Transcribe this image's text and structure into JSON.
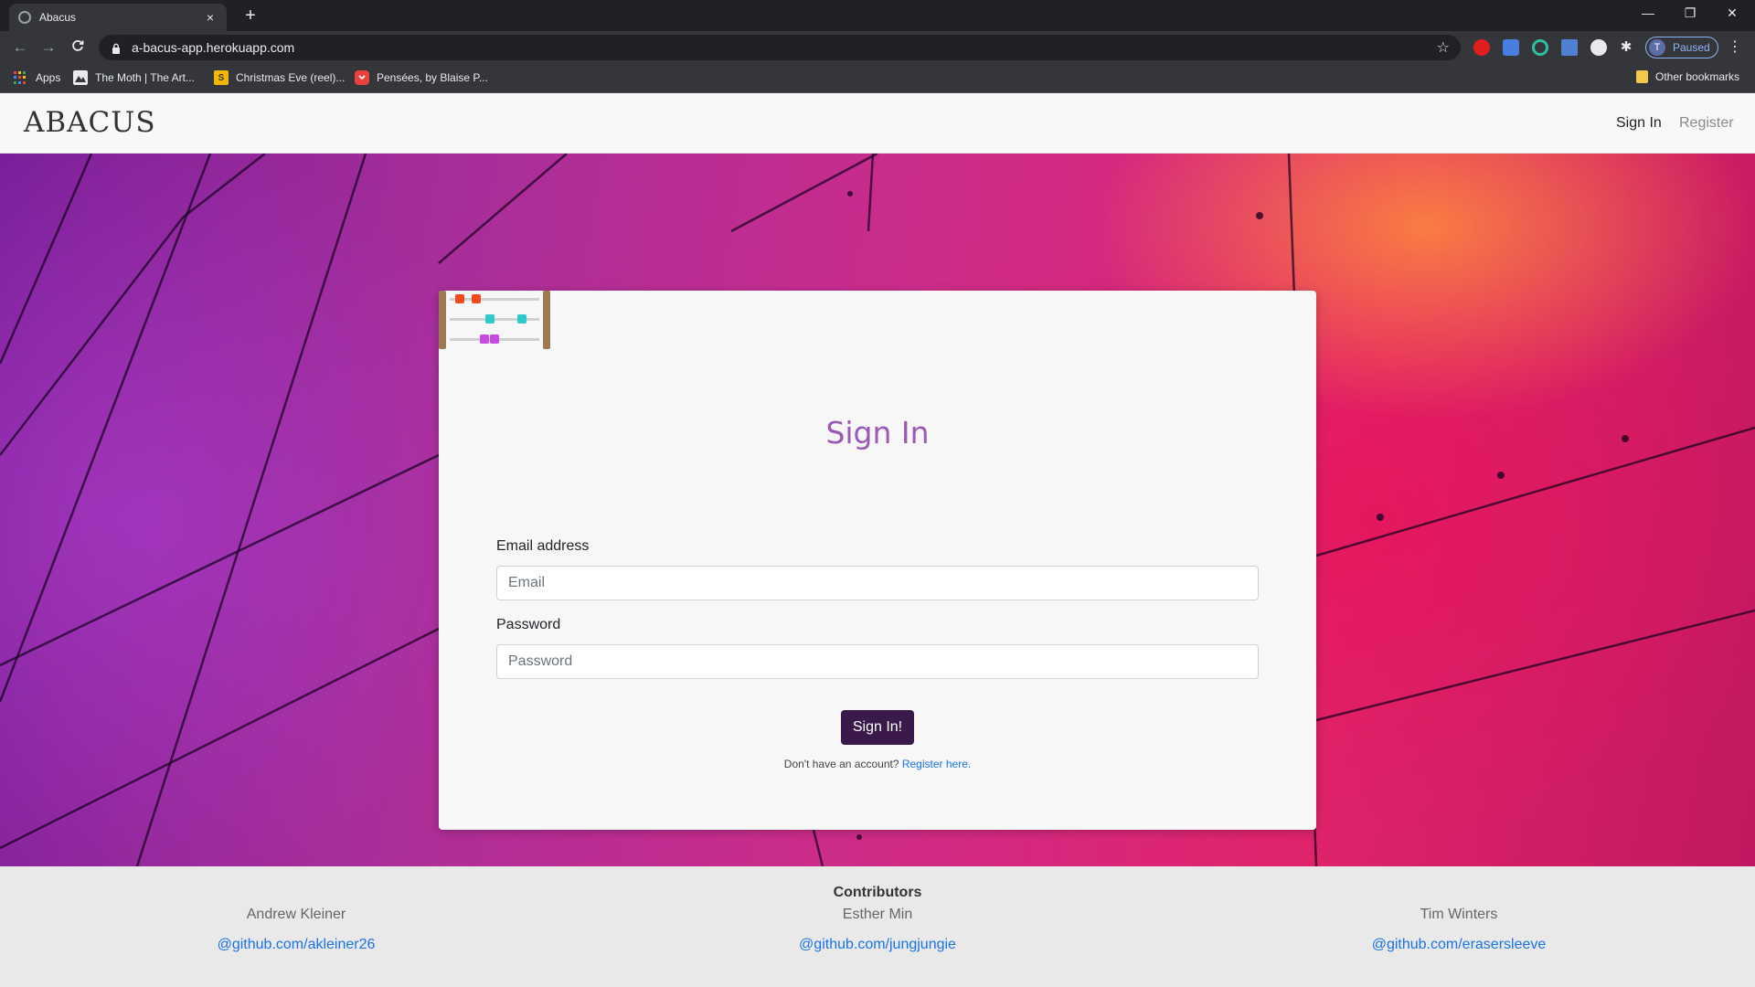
{
  "browser": {
    "tab_title": "Abacus",
    "tab_close": "×",
    "new_tab": "+",
    "url": "a-bacus-app.herokuapp.com",
    "profile_initial": "T",
    "profile_status": "Paused",
    "window_controls": {
      "minimize": "—",
      "restore": "❐",
      "close": "✕"
    },
    "bookmarks": [
      {
        "label": "Apps",
        "icon": "apps-grid-icon"
      },
      {
        "label": "The Moth | The Art...",
        "icon": "moth-icon"
      },
      {
        "label": "Christmas Eve (reel)...",
        "icon": "s-icon",
        "icon_text": "S"
      },
      {
        "label": "Pensées, by Blaise P...",
        "icon": "pocket-icon"
      }
    ],
    "other_bookmarks": "Other bookmarks"
  },
  "site": {
    "brand": "ABACUS",
    "nav": {
      "sign_in": "Sign In",
      "register": "Register"
    }
  },
  "signin": {
    "title": "Sign In",
    "email_label": "Email address",
    "email_placeholder": "Email",
    "email_value": "",
    "password_label": "Password",
    "password_placeholder": "Password",
    "password_value": "",
    "submit": "Sign In!",
    "no_account": "Don't have an account?",
    "register_link": "Register here."
  },
  "footer": {
    "title": "Contributors",
    "contributors": [
      {
        "name": "Andrew Kleiner",
        "link": "@github.com/akleiner26"
      },
      {
        "name": "Esther Min",
        "link": "@github.com/jungjungie"
      },
      {
        "name": "Tim Winters",
        "link": "@github.com/erasersleeve"
      }
    ]
  },
  "colors": {
    "title_purple": "#9b59b6",
    "button": "#3a1a4a",
    "link": "#1a73e8",
    "bead_orange": "#f04a1e",
    "bead_teal": "#2ec9c9",
    "bead_magenta": "#c94ae0",
    "abacus_frame": "#9c7a55"
  }
}
